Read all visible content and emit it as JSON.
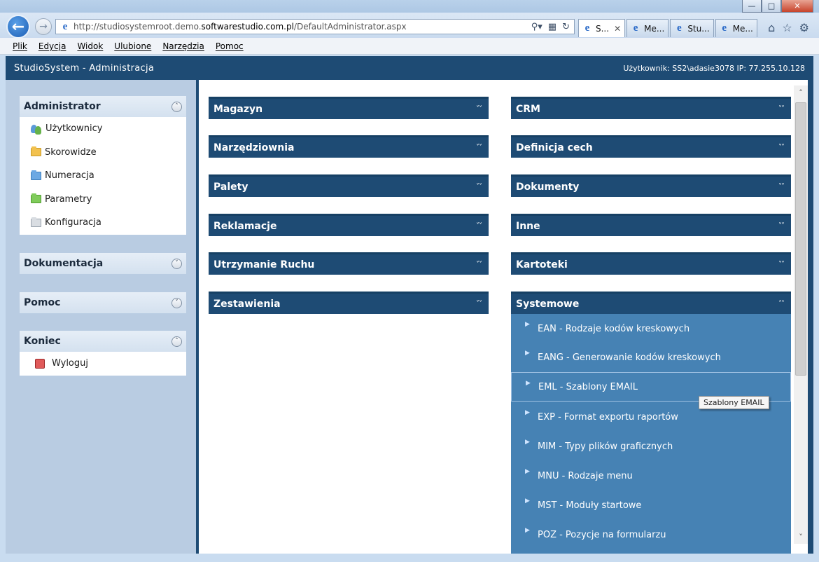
{
  "browser": {
    "url_prefix": "http://studiosystemroot.demo.",
    "url_domain": "softwarestudio.com.pl",
    "url_path": "/DefaultAdministrator.aspx",
    "tabs": [
      {
        "label": "S...",
        "active": true
      },
      {
        "label": "Me..."
      },
      {
        "label": "Stu..."
      },
      {
        "label": "Me..."
      }
    ],
    "menu": [
      "Plik",
      "Edycja",
      "Widok",
      "Ulubione",
      "Narzędzia",
      "Pomoc"
    ]
  },
  "app": {
    "title": "StudioSystem - Administracja",
    "user_info": "Użytkownik: SS2\\adasie3078 IP: 77.255.10.128"
  },
  "sidebar": {
    "administrator": {
      "title": "Administrator",
      "items": [
        "Użytkownicy",
        "Skorowidze",
        "Numeracja",
        "Parametry",
        "Konfiguracja"
      ]
    },
    "dokumentacja": {
      "title": "Dokumentacja"
    },
    "pomoc": {
      "title": "Pomoc"
    },
    "koniec": {
      "title": "Koniec",
      "items": [
        "Wyloguj"
      ]
    }
  },
  "panels": {
    "left": [
      "Magazyn",
      "Narzędziownia",
      "Palety",
      "Reklamacje",
      "Utrzymanie Ruchu",
      "Zestawienia"
    ],
    "right": [
      "CRM",
      "Definicja cech",
      "Dokumenty",
      "Inne",
      "Kartoteki",
      "Systemowe"
    ]
  },
  "systemowe_items": [
    "EAN - Rodzaje kodów kreskowych",
    "EANG - Generowanie kodów kreskowych",
    "EML - Szablony EMAIL",
    "EXP - Format exportu raportów",
    "MIM - Typy plików graficznych",
    "MNU - Rodzaje menu",
    "MST - Moduły startowe",
    "POZ - Pozycje na formularzu"
  ],
  "tooltip": "Szablony EMAIL",
  "colors": {
    "header": "#1e4b74",
    "sidebar": "#b9cce2",
    "list": "#4682b4"
  }
}
